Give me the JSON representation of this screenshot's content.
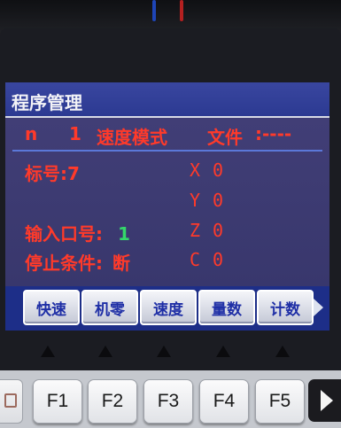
{
  "screen": {
    "title": "程序管理",
    "status": {
      "n_label": "n",
      "n_value": "1",
      "mode": "速度模式",
      "file_label": "文件",
      "file_value": ":----"
    },
    "fields": {
      "label_no": "标号:7",
      "input_port_label": "输入口号:",
      "input_port_value": "1",
      "stop_cond_label": "停止条件:",
      "stop_cond_value": "断"
    },
    "axes": [
      {
        "name": "X",
        "value": "0"
      },
      {
        "name": "Y",
        "value": "0"
      },
      {
        "name": "Z",
        "value": "0"
      },
      {
        "name": "C",
        "value": "0"
      }
    ],
    "softkeys": [
      "快速",
      "机零",
      "速度",
      "量数",
      "计数"
    ],
    "more_icon": "right-triangle"
  },
  "keypad": {
    "keys": [
      "F1",
      "F2",
      "F3",
      "F4",
      "F5"
    ],
    "next_icon": "play-triangle"
  },
  "colors": {
    "screen_bg": "#3d3b72",
    "title_bar": "#2c3a92",
    "text_red": "#ff3a2a",
    "text_green": "#34d86a",
    "softkey_text": "#1f2fa6"
  }
}
